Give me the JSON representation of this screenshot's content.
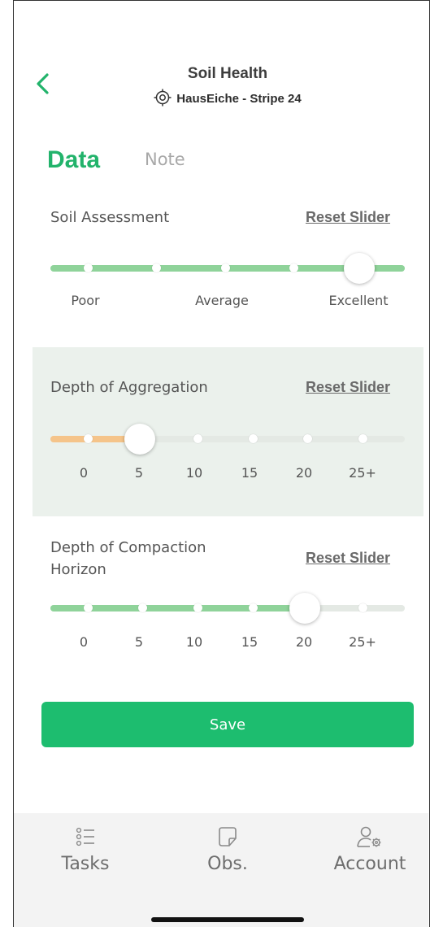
{
  "header": {
    "title": "Soil Health",
    "location": "HausEiche - Stripe 24"
  },
  "tabs": [
    {
      "label": "Data",
      "active": true
    },
    {
      "label": "Note",
      "active": false
    }
  ],
  "sliders": [
    {
      "label": "Soil Assessment",
      "reset_label": "Reset Slider",
      "tick_labels": [
        "Poor",
        "Average",
        "Excellent"
      ],
      "value": "Excellent",
      "color": "#8fd39a"
    },
    {
      "label": "Depth of Aggregation",
      "reset_label": "Reset Slider",
      "tick_labels": [
        "0",
        "5",
        "10",
        "15",
        "20",
        "25+"
      ],
      "value": "5",
      "color": "#f5c48a"
    },
    {
      "label": "Depth of Compaction\nHorizon",
      "reset_label": "Reset Slider",
      "tick_labels": [
        "0",
        "5",
        "10",
        "15",
        "20",
        "25+"
      ],
      "value": "20",
      "color": "#8fd39a"
    }
  ],
  "save_label": "Save",
  "nav": [
    {
      "label": "Tasks",
      "icon": "list-icon"
    },
    {
      "label": "Obs.",
      "icon": "note-icon"
    },
    {
      "label": "Account",
      "icon": "user-settings-icon"
    }
  ],
  "colors": {
    "accent": "#22b36b",
    "button": "#1dbd6f",
    "track_inactive": "#e4e9e4",
    "highlight_bg": "#ebf1ec"
  }
}
